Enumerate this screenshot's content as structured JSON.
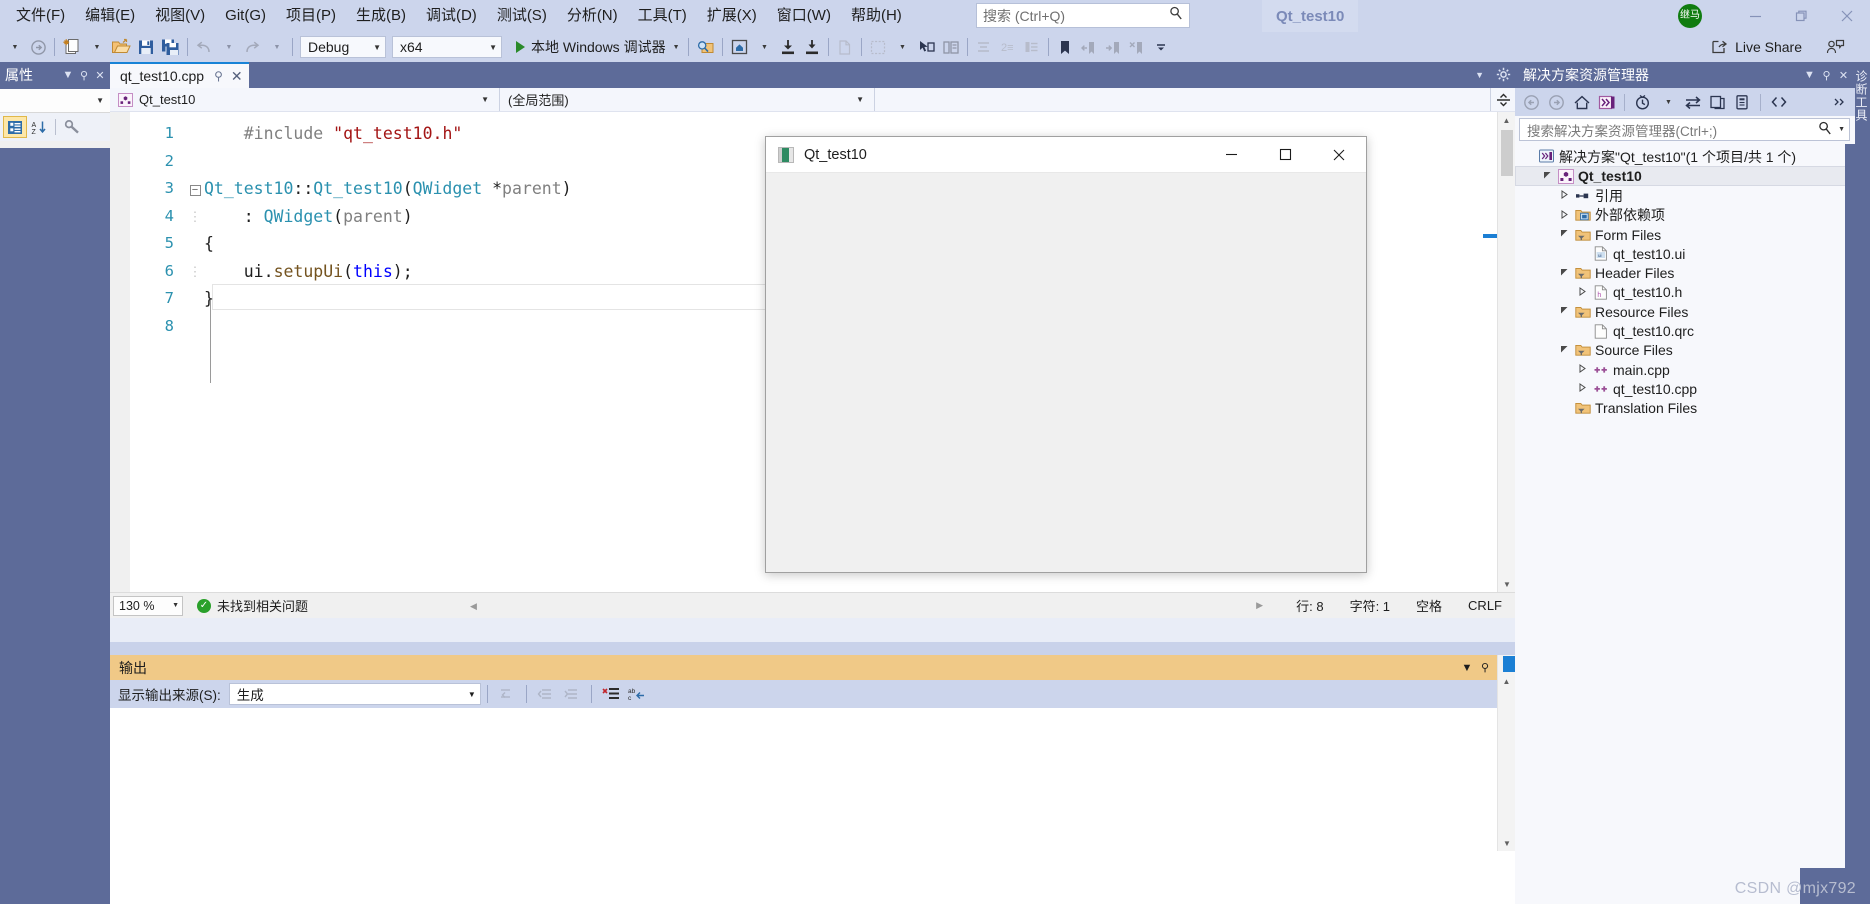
{
  "titlebar": {
    "menus": [
      {
        "label": "文件(F)"
      },
      {
        "label": "编辑(E)"
      },
      {
        "label": "视图(V)"
      },
      {
        "label": "Git(G)"
      },
      {
        "label": "项目(P)"
      },
      {
        "label": "生成(B)"
      },
      {
        "label": "调试(D)"
      },
      {
        "label": "测试(S)"
      },
      {
        "label": "分析(N)"
      },
      {
        "label": "工具(T)"
      },
      {
        "label": "扩展(X)"
      },
      {
        "label": "窗口(W)"
      },
      {
        "label": "帮助(H)"
      }
    ],
    "search_placeholder": "搜索 (Ctrl+Q)",
    "project_title": "Qt_test10",
    "account_initials": "继马",
    "minimize": "—",
    "restore": "❐",
    "close": "✕"
  },
  "toolbar": {
    "configuration": "Debug",
    "platform": "x64",
    "run_label": "本地 Windows 调试器",
    "live_share": "Live Share"
  },
  "properties_panel": {
    "title": "属性",
    "dropdown_icon": "chevron-down-icon",
    "pin_icon": "pin-icon",
    "close_icon": "close-icon"
  },
  "editor": {
    "tab_label": "qt_test10.cpp",
    "nav_scope": "Qt_test10",
    "nav_member": "(全局范围)",
    "nav_third": "",
    "code_lines": [
      {
        "num": "1",
        "fold": "",
        "tokens": [
          {
            "t": "    ",
            "c": "tk-pun"
          },
          {
            "t": "#include",
            "c": "tk-pp"
          },
          {
            "t": " ",
            "c": "tk-pun"
          },
          {
            "t": "\"qt_test10.h\"",
            "c": "tk-str"
          }
        ]
      },
      {
        "num": "2",
        "fold": "",
        "tokens": []
      },
      {
        "num": "3",
        "fold": "minus",
        "tokens": [
          {
            "t": "Qt_test10",
            "c": "tk-type"
          },
          {
            "t": "::",
            "c": "tk-pun"
          },
          {
            "t": "Qt_test10",
            "c": "tk-type"
          },
          {
            "t": "(",
            "c": "tk-pun"
          },
          {
            "t": "QWidget",
            "c": "tk-type"
          },
          {
            "t": " *",
            "c": "tk-pun"
          },
          {
            "t": "parent",
            "c": "tk-var"
          },
          {
            "t": ")",
            "c": "tk-pun"
          }
        ]
      },
      {
        "num": "4",
        "fold": "dash",
        "tokens": [
          {
            "t": "    : ",
            "c": "tk-pun"
          },
          {
            "t": "QWidget",
            "c": "tk-type"
          },
          {
            "t": "(",
            "c": "tk-pun"
          },
          {
            "t": "parent",
            "c": "tk-var"
          },
          {
            "t": ")",
            "c": "tk-pun"
          }
        ]
      },
      {
        "num": "5",
        "fold": "",
        "tokens": [
          {
            "t": "{",
            "c": "tk-pun"
          }
        ]
      },
      {
        "num": "6",
        "fold": "dash",
        "tokens": [
          {
            "t": "    ",
            "c": "tk-pun"
          },
          {
            "t": "ui",
            "c": "tk-id"
          },
          {
            "t": ".",
            "c": "tk-pun"
          },
          {
            "t": "setupUi",
            "c": "tk-fn"
          },
          {
            "t": "(",
            "c": "tk-pun"
          },
          {
            "t": "this",
            "c": "tk-kw"
          },
          {
            "t": ");",
            "c": "tk-pun"
          }
        ]
      },
      {
        "num": "7",
        "fold": "",
        "tokens": [
          {
            "t": "}",
            "c": "tk-pun"
          }
        ]
      },
      {
        "num": "8",
        "fold": "",
        "tokens": []
      }
    ],
    "status": {
      "zoom": "130 %",
      "issues": "未找到相关问题",
      "line": "行: 8",
      "col": "字符: 1",
      "spaces": "空格",
      "eol": "CRLF"
    }
  },
  "output_panel": {
    "title": "输出",
    "source_label": "显示输出来源(S):",
    "source_value": "生成",
    "dropdown_icon": "chevron-down-icon",
    "pin_icon": "pin-icon",
    "close_icon": "close-icon",
    "content": ""
  },
  "solution_explorer": {
    "title": "解决方案资源管理器",
    "search_placeholder": "搜索解决方案资源管理器(Ctrl+;)",
    "vertical_tab": "诊断工具",
    "tree": [
      {
        "label": "解决方案\"Qt_test10\"(1 个项目/共 1 个)",
        "indent": 0,
        "expander": "none",
        "icon": "solution-icon",
        "bold": false,
        "selected": false
      },
      {
        "label": "Qt_test10",
        "indent": 1,
        "expander": "expanded",
        "icon": "project-icon",
        "bold": true,
        "selected": true
      },
      {
        "label": "引用",
        "indent": 2,
        "expander": "collapsed",
        "icon": "references-icon",
        "bold": false,
        "selected": false
      },
      {
        "label": "外部依赖项",
        "indent": 2,
        "expander": "collapsed",
        "icon": "folder-blue-icon",
        "bold": false,
        "selected": false
      },
      {
        "label": "Form Files",
        "indent": 2,
        "expander": "expanded",
        "icon": "filter-folder-icon",
        "bold": false,
        "selected": false
      },
      {
        "label": "qt_test10.ui",
        "indent": 3,
        "expander": "none",
        "icon": "ui-file-icon",
        "bold": false,
        "selected": false
      },
      {
        "label": "Header Files",
        "indent": 2,
        "expander": "expanded",
        "icon": "filter-folder-icon",
        "bold": false,
        "selected": false
      },
      {
        "label": "qt_test10.h",
        "indent": 3,
        "expander": "collapsed",
        "icon": "h-file-icon",
        "bold": false,
        "selected": false
      },
      {
        "label": "Resource Files",
        "indent": 2,
        "expander": "expanded",
        "icon": "filter-folder-icon",
        "bold": false,
        "selected": false
      },
      {
        "label": "qt_test10.qrc",
        "indent": 3,
        "expander": "none",
        "icon": "file-icon",
        "bold": false,
        "selected": false
      },
      {
        "label": "Source Files",
        "indent": 2,
        "expander": "expanded",
        "icon": "filter-folder-icon",
        "bold": false,
        "selected": false
      },
      {
        "label": "main.cpp",
        "indent": 3,
        "expander": "collapsed",
        "icon": "cpp-file-icon",
        "bold": false,
        "selected": false
      },
      {
        "label": "qt_test10.cpp",
        "indent": 3,
        "expander": "collapsed",
        "icon": "cpp-file-icon",
        "bold": false,
        "selected": false
      },
      {
        "label": "Translation Files",
        "indent": 2,
        "expander": "none",
        "icon": "filter-folder-icon",
        "bold": false,
        "selected": false
      }
    ]
  },
  "qt_window": {
    "title": "Qt_test10",
    "minimize": "minimize-icon",
    "maximize": "maximize-icon",
    "close": "close-icon"
  },
  "watermark": "CSDN @mjx792",
  "colors": {
    "chrome": "#ccd5ec",
    "panel_header": "#5d6b99",
    "output_header": "#f0c987",
    "accent_blue": "#1b7fd4",
    "run_green": "#2a8a2a",
    "avatar_green": "#107c10"
  }
}
